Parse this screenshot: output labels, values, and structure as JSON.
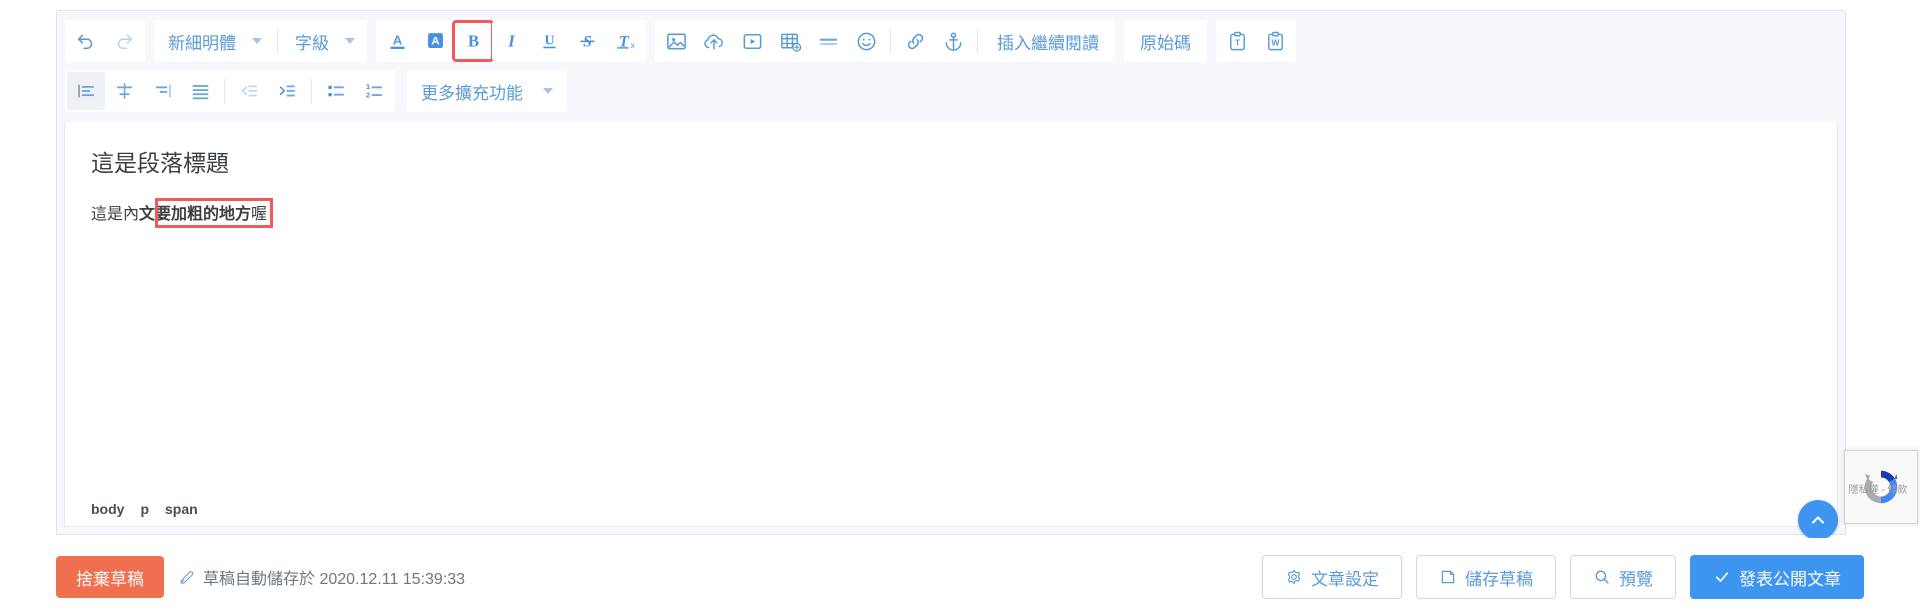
{
  "editor": {
    "toolbar_row1": {
      "history": [
        {
          "name": "undo-icon",
          "title": "復原"
        },
        {
          "name": "redo-icon",
          "title": "重做"
        }
      ],
      "font_family": {
        "label": "新細明體"
      },
      "font_size": {
        "label": "字級"
      },
      "format_icons": [
        {
          "name": "text-color-icon",
          "glyph": "A",
          "title": "文字顏色"
        },
        {
          "name": "background-color-icon",
          "glyph": "A",
          "title": "背景顏色"
        },
        {
          "name": "bold-icon",
          "glyph": "B",
          "title": "粗體",
          "highlighted": true
        },
        {
          "name": "italic-icon",
          "glyph": "I",
          "title": "斜體"
        },
        {
          "name": "underline-icon",
          "glyph": "U",
          "title": "底線"
        },
        {
          "name": "strikethrough-icon",
          "glyph": "S",
          "title": "刪除線"
        },
        {
          "name": "remove-format-icon",
          "glyph": "Tx",
          "title": "清除格式"
        }
      ],
      "insert_icons": [
        {
          "name": "image-icon",
          "title": "插入圖片"
        },
        {
          "name": "cloud-upload-icon",
          "title": "上傳檔案"
        },
        {
          "name": "video-icon",
          "title": "插入影片"
        },
        {
          "name": "table-icon",
          "title": "插入表格"
        },
        {
          "name": "horizontal-rule-icon",
          "title": "水平線"
        },
        {
          "name": "emoji-icon",
          "title": "表情符號"
        },
        {
          "name": "link-icon",
          "title": "插入連結"
        },
        {
          "name": "anchor-icon",
          "title": "錨點"
        }
      ],
      "read_more_label": "插入繼續閱讀",
      "source_code_label": "原始碼",
      "paste_icons": [
        {
          "name": "paste-as-text-icon",
          "glyph": "T",
          "title": "貼上純文字"
        },
        {
          "name": "paste-from-word-icon",
          "glyph": "W",
          "title": "從 Word 貼上"
        }
      ]
    },
    "toolbar_row2": {
      "align_icons": [
        {
          "name": "align-left-icon",
          "title": "靠左對齊",
          "active": true
        },
        {
          "name": "align-center-icon",
          "title": "置中對齊",
          "active": false
        },
        {
          "name": "align-right-icon",
          "title": "靠右對齊",
          "active": false
        },
        {
          "name": "align-justify-icon",
          "title": "左右對齊",
          "active": false
        },
        {
          "name": "outdent-icon",
          "title": "減少縮排",
          "active": false
        },
        {
          "name": "indent-icon",
          "title": "增加縮排",
          "active": false
        },
        {
          "name": "bullet-list-icon",
          "title": "項目符號清單",
          "active": false
        },
        {
          "name": "numbered-list-icon",
          "title": "編號清單",
          "active": false
        }
      ],
      "more_extensions_label": "更多擴充功能"
    },
    "document": {
      "heading": "這是段落標題",
      "paragraph_prefix": "這是內",
      "paragraph_bold": "文要加粗的地方",
      "paragraph_suffix": "喔！"
    },
    "element_path": [
      "body",
      "p",
      "span"
    ]
  },
  "bottom_bar": {
    "discard_label": "捨棄草稿",
    "autosave_text": "草稿自動儲存於 2020.12.11 15:39:33",
    "autosave_icon": "edit-pencil-icon",
    "settings_label": "文章設定",
    "save_draft_label": "儲存草稿",
    "preview_label": "預覽",
    "publish_label": "發表公開文章"
  },
  "widgets": {
    "recaptcha_icon": "recaptcha-icon",
    "recaptcha_terms": "隱私權 - 條款",
    "scroll_top_icon": "chevron-up-icon"
  },
  "colors": {
    "accent_blue": "#3d95ef",
    "icon_blue": "#5b9bd5",
    "discard_orange": "#ef6f4e",
    "highlight_red": "#ef5a5a",
    "toolbar_bg": "#f7f8fb"
  }
}
